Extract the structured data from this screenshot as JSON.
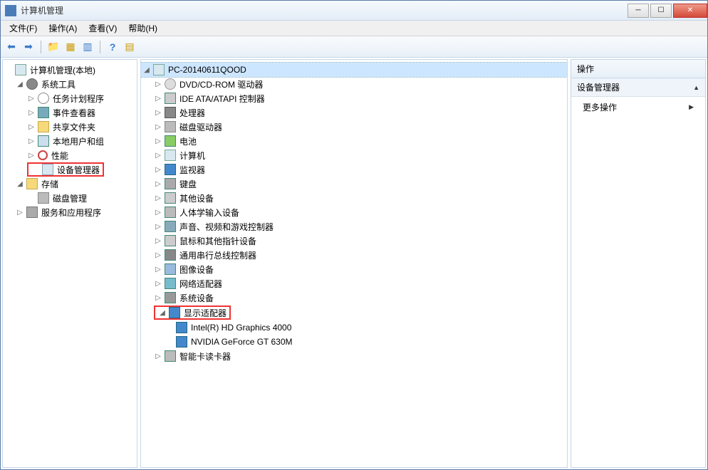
{
  "window": {
    "title": "计算机管理"
  },
  "menubar": [
    {
      "label": "文件(F)"
    },
    {
      "label": "操作(A)"
    },
    {
      "label": "查看(V)"
    },
    {
      "label": "帮助(H)"
    }
  ],
  "toolbar_icons": [
    "back",
    "forward",
    "up",
    "props",
    "refresh",
    "help",
    "list"
  ],
  "left_tree": {
    "root": "计算机管理(本地)",
    "system_tools": {
      "label": "系统工具",
      "children": [
        {
          "id": "task-scheduler",
          "label": "任务计划程序",
          "icon": "clock"
        },
        {
          "id": "event-viewer",
          "label": "事件查看器",
          "icon": "book"
        },
        {
          "id": "shared-folders",
          "label": "共享文件夹",
          "icon": "share"
        },
        {
          "id": "local-users",
          "label": "本地用户和组",
          "icon": "group"
        },
        {
          "id": "performance",
          "label": "性能",
          "icon": "perf"
        },
        {
          "id": "device-manager",
          "label": "设备管理器",
          "icon": "device",
          "highlighted": true
        }
      ]
    },
    "storage": {
      "label": "存储",
      "children": [
        {
          "id": "disk-mgmt",
          "label": "磁盘管理",
          "icon": "disk"
        }
      ]
    },
    "services": {
      "label": "服务和应用程序",
      "icon": "service"
    }
  },
  "mid_tree": {
    "root": "PC-20140611QOOD",
    "children": [
      {
        "id": "dvd",
        "label": "DVD/CD-ROM 驱动器",
        "icon": "dvd"
      },
      {
        "id": "ide",
        "label": "IDE ATA/ATAPI 控制器",
        "icon": "ide"
      },
      {
        "id": "cpu",
        "label": "处理器",
        "icon": "cpu"
      },
      {
        "id": "diskdrive",
        "label": "磁盘驱动器",
        "icon": "disk"
      },
      {
        "id": "battery",
        "label": "电池",
        "icon": "battery"
      },
      {
        "id": "computer",
        "label": "计算机",
        "icon": "pc"
      },
      {
        "id": "monitor",
        "label": "监视器",
        "icon": "monitor"
      },
      {
        "id": "keyboard",
        "label": "键盘",
        "icon": "keyboard"
      },
      {
        "id": "other",
        "label": "其他设备",
        "icon": "other"
      },
      {
        "id": "hid",
        "label": "人体学输入设备",
        "icon": "hid"
      },
      {
        "id": "sound",
        "label": "声音、视频和游戏控制器",
        "icon": "sound"
      },
      {
        "id": "mouse",
        "label": "鼠标和其他指针设备",
        "icon": "mouse"
      },
      {
        "id": "usb",
        "label": "通用串行总线控制器",
        "icon": "usb"
      },
      {
        "id": "imaging",
        "label": "图像设备",
        "icon": "imaging"
      },
      {
        "id": "network",
        "label": "网络适配器",
        "icon": "net"
      },
      {
        "id": "system",
        "label": "系统设备",
        "icon": "sys"
      }
    ],
    "display_adapter": {
      "label": "显示适配器",
      "children": [
        {
          "id": "intel-hd",
          "label": "Intel(R) HD Graphics 4000"
        },
        {
          "id": "nvidia",
          "label": "NVIDIA GeForce GT 630M"
        }
      ]
    },
    "smartcard": {
      "label": "智能卡读卡器",
      "icon": "card"
    }
  },
  "actions_panel": {
    "header": "操作",
    "section": "设备管理器",
    "more": "更多操作"
  }
}
